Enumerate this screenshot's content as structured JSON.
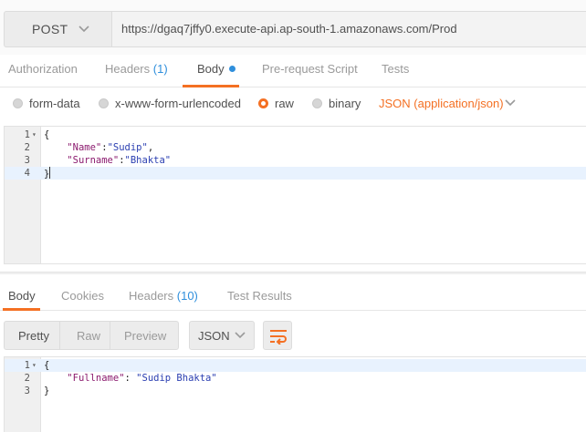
{
  "request": {
    "method": "POST",
    "url": "https://dgaq7jffy0.execute-api.ap-south-1.amazonaws.com/Prod"
  },
  "request_tabs": {
    "authorization": "Authorization",
    "headers": "Headers",
    "headers_count": "(1)",
    "body": "Body",
    "pre_request": "Pre-request Script",
    "tests": "Tests"
  },
  "body_types": {
    "form_data": "form-data",
    "urlencoded": "x-www-form-urlencoded",
    "raw": "raw",
    "binary": "binary",
    "selected": "raw",
    "content_type": "JSON (application/json)"
  },
  "request_body": {
    "line_numbers": [
      "1",
      "2",
      "3",
      "4"
    ],
    "open_brace": "{",
    "close_brace": "}",
    "name_key": "\"Name\"",
    "name_val": "\"Sudip\"",
    "surname_key": "\"Surname\"",
    "surname_val": "\"Bhakta\""
  },
  "response_tabs": {
    "body": "Body",
    "cookies": "Cookies",
    "headers": "Headers",
    "headers_count": "(10)",
    "test_results": "Test Results"
  },
  "view_options": {
    "pretty": "Pretty",
    "raw": "Raw",
    "preview": "Preview",
    "format": "JSON"
  },
  "response_body": {
    "line_numbers": [
      "1",
      "2",
      "3"
    ],
    "open_brace": "{",
    "close_brace": "}",
    "fullname_key": "\"Fullname\"",
    "fullname_val": "\"Sudip Bhakta\""
  },
  "colors": {
    "accent": "#f47023",
    "link_blue": "#2f8fdc",
    "string_blue": "#2a3eb1",
    "key_purple": "#8b1a6e"
  },
  "icons": {
    "method_dropdown": "chevron-down-icon",
    "content_type_dropdown": "chevron-down-icon",
    "format_dropdown": "chevron-down-icon",
    "wrap": "wrap-lines-icon",
    "fold": "fold-arrow-icon",
    "body_modified": "dot-icon"
  }
}
